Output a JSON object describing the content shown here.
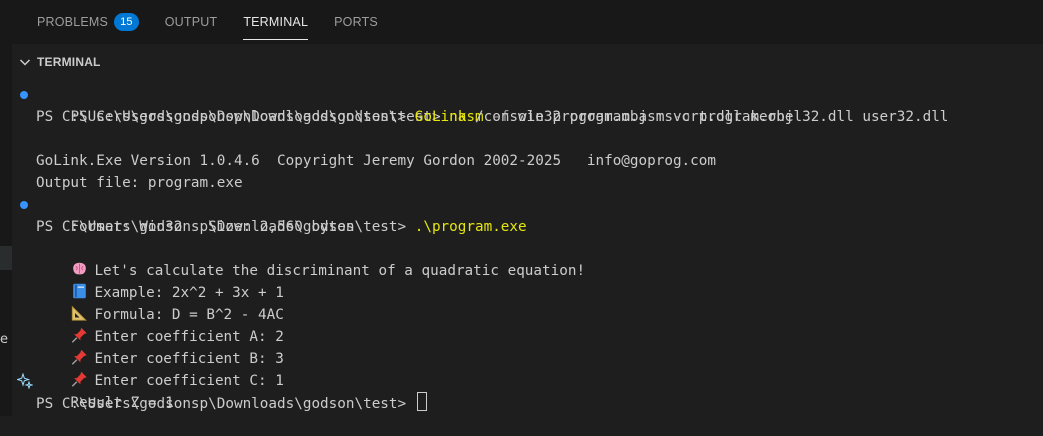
{
  "tabs": [
    {
      "label": "PROBLEMS",
      "badge": "15"
    },
    {
      "label": "OUTPUT"
    },
    {
      "label": "TERMINAL"
    },
    {
      "label": "PORTS"
    }
  ],
  "sidebar_truncated_text": "e",
  "section_header": "TERMINAL",
  "terminal": {
    "prompt": "PS C:\\Users\\godsonsp\\Downloads\\godson\\test> ",
    "line1": {
      "cmd": "nasm",
      "a1": " ",
      "flag": "-f",
      "rest": " win32 program.asm ",
      "flag2": "-o",
      "rest2": " program.obj"
    },
    "line2": {
      "cmd": "GoLink",
      "rest": " /console program.obj msvcrt.dll kernel32.dll user32.dll"
    },
    "golink_version": "GoLink.Exe Version 1.0.4.6  Copyright Jeremy Gordon 2002-2025   info@goprog.com",
    "output_file": "Output file: program.exe",
    "format": "Format: Win32   Size: 2,560 bytes",
    "line_run": {
      "cmd": ".\\program.exe"
    },
    "out1": "Let's calculate the discriminant of a quadratic equation!",
    "out2": "Example: 2x^2 + 3x + 1",
    "out3": "Formula: D = B^2 - 4AC",
    "out4": "Enter coefficient A: 2",
    "out5": "Enter coefficient B: 3",
    "out6": "Enter coefficient C: 1",
    "result": "Result Z = 1"
  },
  "colors": {
    "accent": "#0078d4",
    "command": "#e5e510",
    "dot": "#3794ff"
  },
  "icons": [
    "chevron-down-icon",
    "brain-icon",
    "book-icon",
    "triangular-ruler-icon",
    "pushpin-icon",
    "sparkle-icon"
  ]
}
